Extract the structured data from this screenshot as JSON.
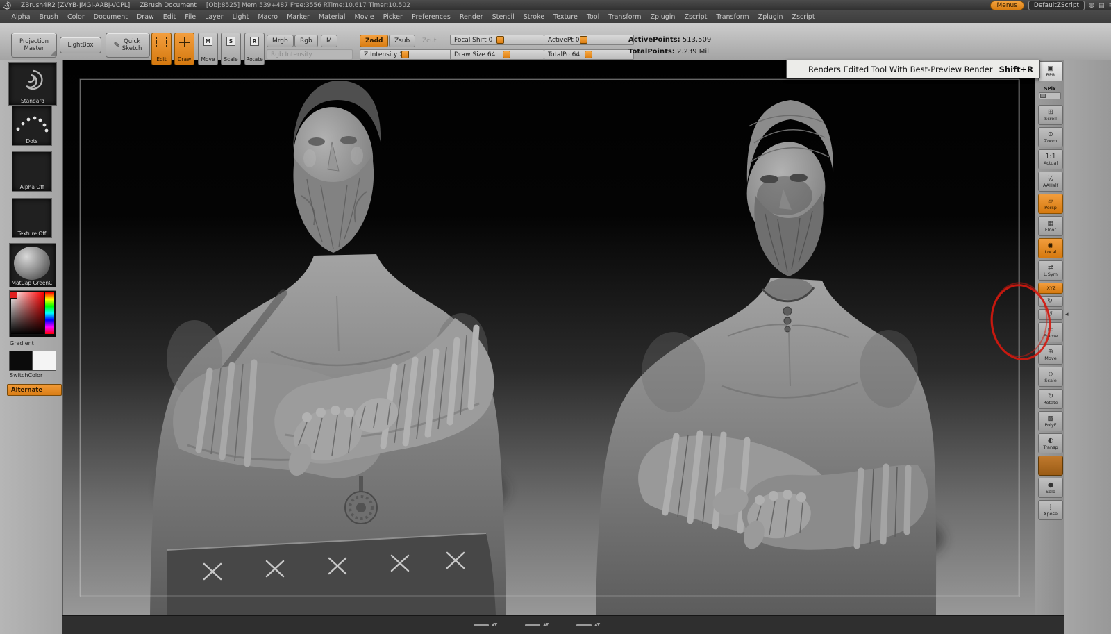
{
  "colors": {
    "accent_orange": "#e8862b",
    "shelf_gray": "#b3b3b3",
    "canvas_top": "#000000",
    "canvas_bottom": "#989898",
    "tooltip_bg": "#ecece9",
    "annotation_red": "#d4180e"
  },
  "title_bar": {
    "app_title": "ZBrush4R2 [ZVYB-JMGI-AABJ-VCPL]",
    "document_title": "ZBrush Document",
    "stats": "[Obj:8525] Mem:539+487 Free:3556 RTime:10.617 Timer:10.502",
    "menus_button": "Menus",
    "default_zscript_button": "DefaultZScript",
    "icons": {
      "session": "◍",
      "list": "▤",
      "grip": "≡"
    }
  },
  "menu_bar": {
    "items": [
      "Alpha",
      "Brush",
      "Color",
      "Document",
      "Draw",
      "Edit",
      "File",
      "Layer",
      "Light",
      "Macro",
      "Marker",
      "Material",
      "Movie",
      "Picker",
      "Preferences",
      "Render",
      "Stencil",
      "Stroke",
      "Texture",
      "Tool",
      "Transform",
      "Zplugin",
      "Zscript",
      "Transform",
      "Zplugin",
      "Zscript"
    ]
  },
  "shelf": {
    "projection_master_line1": "Projection",
    "projection_master_line2": "Master",
    "lightbox": "LightBox",
    "quick_sketch_line1": "Quick",
    "quick_sketch_line2": "Sketch",
    "pencil_glyph": "✎",
    "modes": {
      "edit": "Edit",
      "draw": "Draw",
      "move": "Move",
      "scale": "Scale",
      "rotate": "Rotate",
      "move_badge": "M",
      "scale_badge": "S",
      "rotate_badge": "R"
    },
    "paint": {
      "mrgb": "Mrgb",
      "rgb": "Rgb",
      "m": "M"
    },
    "sculpt": {
      "zadd": "Zadd",
      "zsub": "Zsub",
      "zcut": "Zcut"
    },
    "sliders": {
      "rgb_intensity": {
        "label": "Rgb Intensity",
        "value": ""
      },
      "z_intensity": {
        "label": "Z Intensity",
        "value": "25"
      },
      "focal_shift": {
        "label": "Focal Shift",
        "value": "0"
      },
      "draw_size": {
        "label": "Draw Size",
        "value": "64"
      },
      "active_pt": {
        "label": "ActivePt",
        "value": "0"
      },
      "total_po": {
        "label": "TotalPo",
        "value": "64"
      }
    },
    "points": {
      "active_label": "ActivePoints:",
      "active_value": "513,509",
      "total_label": "TotalPoints:",
      "total_value": "2.239 Mil"
    }
  },
  "left_tray": {
    "brush_name": "Standard",
    "stroke_name": "Dots",
    "alpha_name": "Alpha Off",
    "texture_name": "Texture Off",
    "material_name": "MatCap GreenCl",
    "gradient_label": "Gradient",
    "switch_color_label": "SwitchColor",
    "alternate_label": "Alternate"
  },
  "canvas": {
    "tooltip_text": "Renders Edited Tool With Best-Preview Render",
    "tooltip_shortcut": "Shift+R"
  },
  "right_shelf": {
    "items": [
      {
        "name": "bpr-button",
        "label": "BPR",
        "glyph": "▣",
        "variant": "light"
      },
      {
        "name": "spix-slider",
        "label": "SPix",
        "kind": "slider"
      },
      {
        "name": "scroll-button",
        "label": "Scroll",
        "glyph": "⊞"
      },
      {
        "name": "zoom-button",
        "label": "Zoom",
        "glyph": "⊙"
      },
      {
        "name": "actual-button",
        "label": "Actual",
        "glyph": "1:1"
      },
      {
        "name": "aahalf-button",
        "label": "AAHalf",
        "glyph": "½"
      },
      {
        "name": "persp-button",
        "label": "Persp",
        "glyph": "▱",
        "variant": "orange"
      },
      {
        "name": "floor-button",
        "label": "Floor",
        "glyph": "▦"
      },
      {
        "name": "local-button",
        "label": "Local",
        "glyph": "◉",
        "variant": "orange"
      },
      {
        "name": "lsym-button",
        "label": "L.Sym",
        "glyph": "⇄"
      },
      {
        "name": "xyz-button",
        "label": "XYZ",
        "kind": "mini",
        "variant": "orange"
      },
      {
        "name": "rotate-y-button",
        "label": "",
        "glyph": "↻",
        "kind": "mini"
      },
      {
        "name": "rotate-z-button",
        "label": "",
        "glyph": "↺",
        "kind": "mini"
      },
      {
        "name": "frame-button",
        "label": "Frame",
        "glyph": "▭"
      },
      {
        "name": "move-button",
        "label": "Move",
        "glyph": "⊕"
      },
      {
        "name": "scale-button",
        "label": "Scale",
        "glyph": "◇"
      },
      {
        "name": "rotate-button",
        "label": "Rotate",
        "glyph": "↻"
      },
      {
        "name": "polyf-button",
        "label": "PolyF",
        "glyph": "▩"
      },
      {
        "name": "transp-button",
        "label": "Transp",
        "glyph": "◐"
      },
      {
        "name": "ghost-button",
        "label": "",
        "glyph": "",
        "variant": "brown"
      },
      {
        "name": "solo-button",
        "label": "Solo",
        "glyph": "●"
      },
      {
        "name": "xpose-button",
        "label": "Xpose",
        "glyph": "⋮"
      }
    ]
  },
  "bottom_bar": {
    "scroll_arrows": "▲▼"
  },
  "right_tray": {
    "collapse_arrow": "◂"
  }
}
